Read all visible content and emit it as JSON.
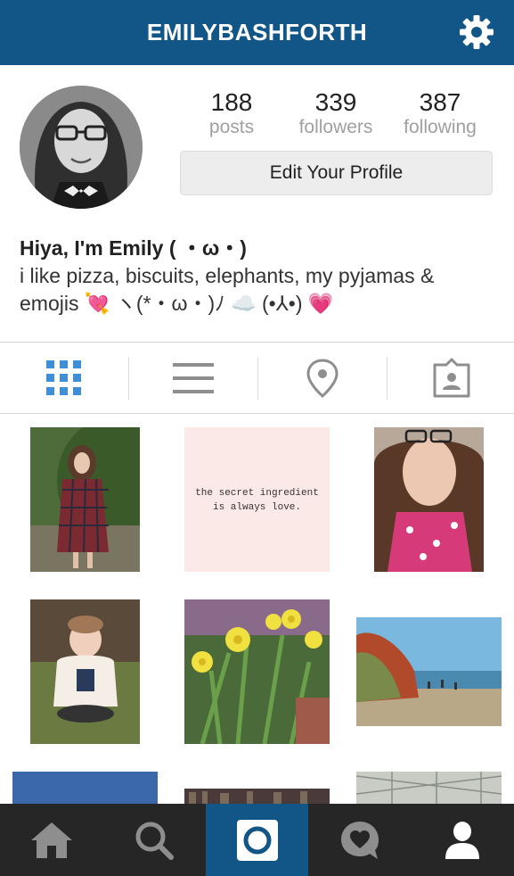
{
  "header": {
    "title": "EMILYBASHFORTH",
    "settings_icon": "gear-icon"
  },
  "profile": {
    "stats": [
      {
        "value": "188",
        "label": "posts"
      },
      {
        "value": "339",
        "label": "followers"
      },
      {
        "value": "387",
        "label": "following"
      }
    ],
    "edit_button": "Edit Your Profile",
    "name_line": "Hiya, I'm Emily ( ・ω・)",
    "bio_line1": "i like pizza, biscuits, elephants, my pyjamas &",
    "bio_line2": "emojis 💘 ヽ(*・ω・)ﾉ ☁️ (•⅄•) 💗"
  },
  "tabs": [
    {
      "name": "grid-view",
      "icon": "grid-icon",
      "active": true
    },
    {
      "name": "list-view",
      "icon": "list-icon",
      "active": false
    },
    {
      "name": "photo-map",
      "icon": "location-pin-icon",
      "active": false
    },
    {
      "name": "tagged-photos",
      "icon": "tagged-person-icon",
      "active": false
    }
  ],
  "posts": [
    {
      "alt": "girl in tartan dress",
      "caption": ""
    },
    {
      "alt": "quote card",
      "caption": "the secret ingredient\nis always love."
    },
    {
      "alt": "selfie with glasses",
      "caption": ""
    },
    {
      "alt": "toddler on grass",
      "caption": ""
    },
    {
      "alt": "yellow daffodils",
      "caption": ""
    },
    {
      "alt": "beach with red cliffs",
      "caption": ""
    }
  ],
  "bottom_nav": [
    {
      "name": "home",
      "icon": "home-icon"
    },
    {
      "name": "search",
      "icon": "search-icon"
    },
    {
      "name": "camera",
      "icon": "camera-icon",
      "active": true
    },
    {
      "name": "activity",
      "icon": "heart-bubble-icon"
    },
    {
      "name": "profile",
      "icon": "person-icon"
    }
  ],
  "colors": {
    "header": "#125688",
    "accent_blue": "#3f8ed8",
    "nav_bg": "#262626"
  }
}
